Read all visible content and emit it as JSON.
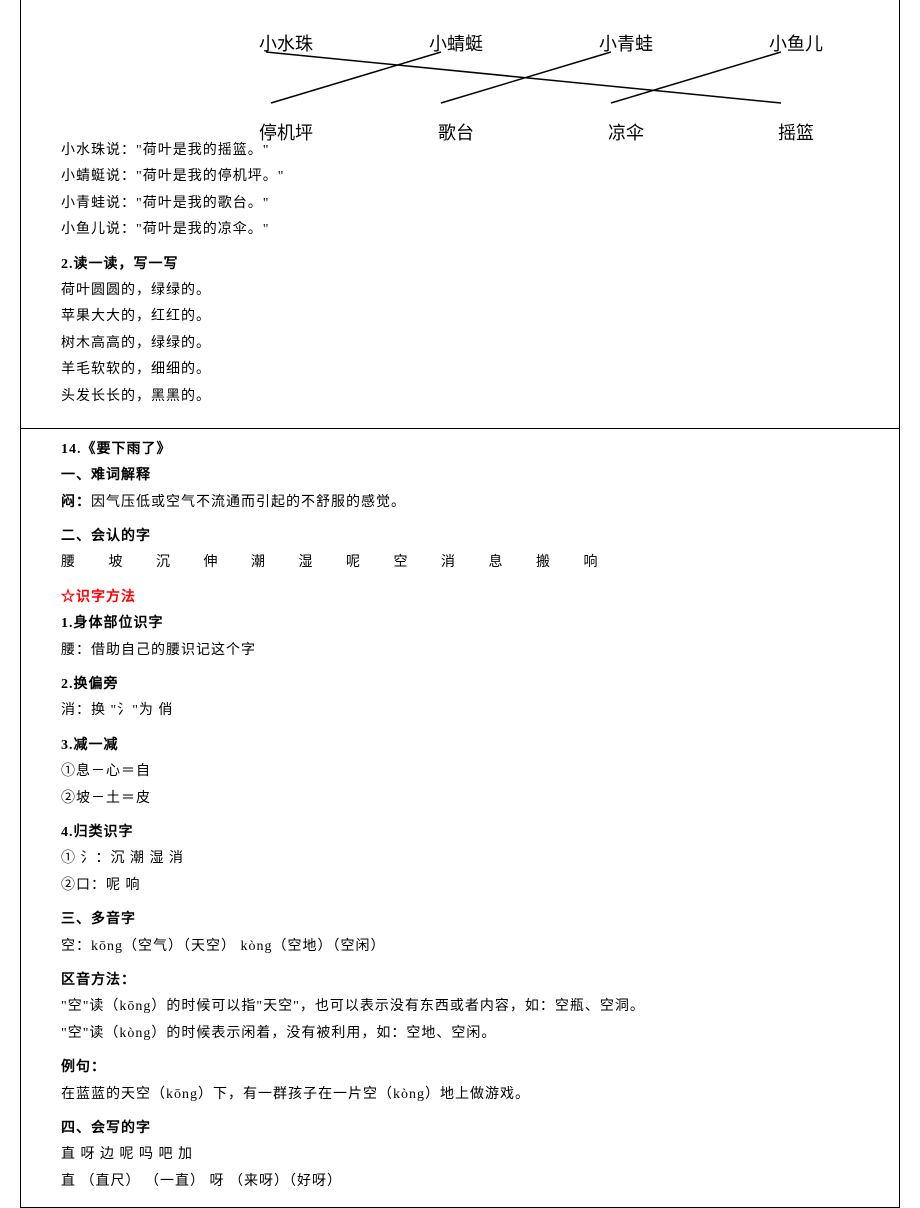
{
  "diagram": {
    "top": [
      "小水珠",
      "小蜻蜓",
      "小青蛙",
      "小鱼儿"
    ],
    "bottom": [
      "停机坪",
      "歌台",
      "凉伞",
      "摇篮"
    ]
  },
  "quotes": [
    "小水珠说：\"荷叶是我的摇篮。\"",
    "小蜻蜓说：\"荷叶是我的停机坪。\"",
    "小青蛙说：\"荷叶是我的歌台。\"",
    "小鱼儿说：\"荷叶是我的凉伞。\""
  ],
  "section2": {
    "heading": "2.读一读，写一写",
    "lines": [
      "荷叶圆圆的，绿绿的。",
      "苹果大大的，红红的。",
      "树木高高的，绿绿的。",
      "羊毛软软的，细细的。",
      "头发长长的，黑黑的。"
    ]
  },
  "lesson14": {
    "title": "14.《要下雨了》",
    "s1_heading": "一、难词解释",
    "s1_line": "闷：因气压低或空气不流通而引起的不舒服的感觉。",
    "s2_heading": "二、会认的字",
    "s2_chars": [
      "腰",
      "坡",
      "沉",
      "伸",
      "潮",
      "湿",
      "呢",
      "空",
      "消",
      "息",
      "搬",
      "响"
    ],
    "method_heading": "☆识字方法",
    "m1_heading": "1.身体部位识字",
    "m1_line": "腰：借助自己的腰识记这个字",
    "m2_heading": "2.换偏旁",
    "m2_line": "消：换 \"氵\"为    俏",
    "m3_heading": "3.减一减",
    "m3_l1": "①息－心＝自",
    "m3_l2": "②坡－土＝皮",
    "m4_heading": "4.归类识字",
    "m4_l1": "① 氵：沉    潮    湿    消",
    "m4_l2": "②口：呢    响",
    "s3_heading": "三、多音字",
    "s3_line": "空：kōng（空气）（天空）    kòng（空地）（空闲）",
    "qy_heading": "区音方法：",
    "qy_l1": "\"空\"读（kōng）的时候可以指\"天空\"，也可以表示没有东西或者内容，如：空瓶、空洞。",
    "qy_l2": "\"空\"读（kòng）的时候表示闲着，没有被利用，如：空地、空闲。",
    "ex_heading": "例句：",
    "ex_line": "在蓝蓝的天空（kōng）下，有一群孩子在一片空（kòng）地上做游戏。",
    "s4_heading": "四、会写的字",
    "s4_l1": "直    呀    边    呢    吗    吧    加",
    "s4_l2": "直  （直尺）  （一直）       呀  （来呀）（好呀）"
  }
}
